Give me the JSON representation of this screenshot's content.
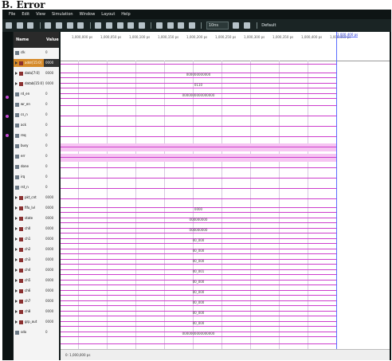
{
  "heading": "B. Error",
  "menu": [
    "File",
    "Edit",
    "View",
    "Simulation",
    "Window",
    "Layout",
    "Help"
  ],
  "toolbar": {
    "zoom_value": "10ns",
    "mode_label": "Default"
  },
  "columns": {
    "name": "Name",
    "value": "Value"
  },
  "time_ticks": [
    "1,000,000 ps",
    "1,000,050 ps",
    "1,000,100 ps",
    "1,000,150 ps",
    "1,000,200 ps",
    "1,000,250 ps",
    "1,000,300 ps",
    "1,000,350 ps",
    "1,000,400 ps",
    "1,000,450 ps"
  ],
  "cursor_time": "1,000,400 ps",
  "signals": [
    {
      "name": "clk",
      "value": "0",
      "type": "bit",
      "expand": false,
      "selected": false,
      "wave": "clock",
      "label": ""
    },
    {
      "name": "addr[15:0]",
      "value": "0000",
      "type": "bus",
      "expand": true,
      "selected": true,
      "wave": "bus",
      "label": "000000000000"
    },
    {
      "name": "data[7:0]",
      "value": "0000",
      "type": "bus",
      "expand": true,
      "selected": false,
      "wave": "bus",
      "label": "0110"
    },
    {
      "name": "datab[15:0]",
      "value": "0000",
      "type": "bus",
      "expand": true,
      "selected": false,
      "wave": "bus",
      "label": "0000000000000000"
    },
    {
      "name": "rd_en",
      "value": "0",
      "type": "bit",
      "expand": false,
      "selected": false,
      "wave": "low",
      "label": ""
    },
    {
      "name": "wr_en",
      "value": "0",
      "type": "bit",
      "expand": false,
      "selected": false,
      "wave": "low",
      "label": ""
    },
    {
      "name": "cs_n",
      "value": "0",
      "type": "bit",
      "expand": false,
      "selected": false,
      "wave": "low",
      "label": ""
    },
    {
      "name": "ack",
      "value": "0",
      "type": "bit",
      "expand": false,
      "selected": false,
      "wave": "low",
      "label": ""
    },
    {
      "name": "req",
      "value": "0",
      "type": "bit",
      "expand": false,
      "selected": false,
      "wave": "fill",
      "label": ""
    },
    {
      "name": "busy",
      "value": "0",
      "type": "bit",
      "expand": false,
      "selected": false,
      "wave": "fill",
      "label": ""
    },
    {
      "name": "err",
      "value": "0",
      "type": "bit",
      "expand": false,
      "selected": false,
      "wave": "low",
      "label": ""
    },
    {
      "name": "done",
      "value": "0",
      "type": "bit",
      "expand": false,
      "selected": false,
      "wave": "low",
      "label": ""
    },
    {
      "name": "irq",
      "value": "0",
      "type": "bit",
      "expand": false,
      "selected": false,
      "wave": "low",
      "label": ""
    },
    {
      "name": "rst_n",
      "value": "0",
      "type": "bit",
      "expand": false,
      "selected": false,
      "wave": "low",
      "label": ""
    },
    {
      "name": "pkt_cnt",
      "value": "0000",
      "type": "bus",
      "expand": true,
      "selected": false,
      "wave": "bus",
      "label": "0000"
    },
    {
      "name": "fifo_lvl",
      "value": "0000",
      "type": "bus",
      "expand": true,
      "selected": false,
      "wave": "bus",
      "label": "000000000"
    },
    {
      "name": "state",
      "value": "0000",
      "type": "bus",
      "expand": true,
      "selected": false,
      "wave": "bus",
      "label": "000000000"
    },
    {
      "name": "ch0",
      "value": "0000",
      "type": "bus",
      "expand": true,
      "selected": false,
      "wave": "bus",
      "label": "00_000"
    },
    {
      "name": "ch1",
      "value": "0000",
      "type": "bus",
      "expand": true,
      "selected": false,
      "wave": "bus",
      "label": "00_000"
    },
    {
      "name": "ch2",
      "value": "0000",
      "type": "bus",
      "expand": true,
      "selected": false,
      "wave": "bus",
      "label": "00_000"
    },
    {
      "name": "ch3",
      "value": "0000",
      "type": "bus",
      "expand": true,
      "selected": false,
      "wave": "bus",
      "label": "00_001"
    },
    {
      "name": "ch4",
      "value": "0000",
      "type": "bus",
      "expand": true,
      "selected": false,
      "wave": "bus",
      "label": "00_000"
    },
    {
      "name": "ch5",
      "value": "0000",
      "type": "bus",
      "expand": true,
      "selected": false,
      "wave": "bus",
      "label": "00_000"
    },
    {
      "name": "ch6",
      "value": "0000",
      "type": "bus",
      "expand": true,
      "selected": false,
      "wave": "bus",
      "label": "00_000"
    },
    {
      "name": "ch7",
      "value": "0000",
      "type": "bus",
      "expand": true,
      "selected": false,
      "wave": "bus",
      "label": "00_000"
    },
    {
      "name": "ch8",
      "value": "0000",
      "type": "bus",
      "expand": true,
      "selected": false,
      "wave": "bus",
      "label": "00_000"
    },
    {
      "name": "grp_out",
      "value": "0000",
      "type": "bus",
      "expand": true,
      "selected": false,
      "wave": "bus",
      "label": "0000000000000000"
    },
    {
      "name": "sdo",
      "value": "0",
      "type": "bit",
      "expand": false,
      "selected": false,
      "wave": "low",
      "label": ""
    }
  ],
  "status_text": "0: 1,000,000 ps",
  "colors": {
    "waveform": "#cc3dcc",
    "selection": "#d58a2a",
    "cursor": "#5b6cff"
  }
}
